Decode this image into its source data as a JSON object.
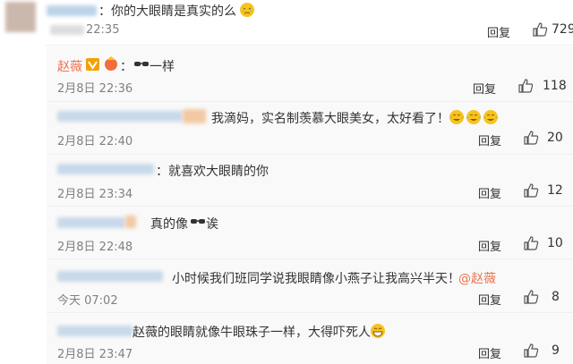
{
  "main_comment": {
    "text": "：你的大眼睛是真实的么",
    "time": "22:35",
    "reply_label": "回复",
    "likes": "729"
  },
  "replies": [
    {
      "user": "赵薇",
      "text": "：",
      "text2": "一样",
      "time": "2月8日 22:36",
      "reply_label": "回复",
      "likes": "118"
    },
    {
      "text": "我滴妈，实名制羡慕大眼美女，太好看了！",
      "time": "2月8日 22:40",
      "reply_label": "回复",
      "likes": "20"
    },
    {
      "text": "：就喜欢大眼睛的你",
      "time": "2月8日 23:34",
      "reply_label": "回复",
      "likes": "12"
    },
    {
      "text": "真的像",
      "text2": "诶",
      "time": "2月8日 22:48",
      "reply_label": "回复",
      "likes": "10"
    },
    {
      "text": "小时候我们班同学说我眼睛像小燕子让我高兴半天！",
      "mention": "@赵薇",
      "time": "今天 07:02",
      "reply_label": "回复",
      "likes": "8"
    },
    {
      "text": "赵薇的眼睛就像牛眼珠子一样，大得吓死人",
      "time": "2月8日 23:47",
      "reply_label": "回复",
      "likes": "9"
    }
  ],
  "colors": {
    "link": "#eb7350",
    "verified_badge": "#f2a100",
    "emoji": "#f7c31e"
  },
  "icons": [
    "thumbs-up-icon",
    "crying-laughing-emoji",
    "sunglasses-emoji",
    "verified-badge-icon",
    "grin-emoji"
  ]
}
